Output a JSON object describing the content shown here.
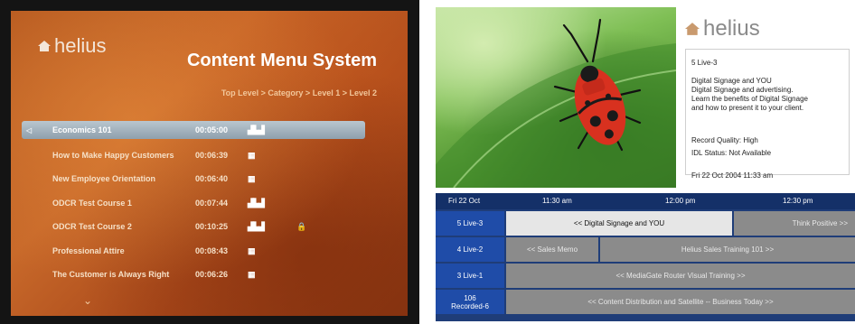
{
  "left": {
    "logo_text": "helius",
    "title": "Content Menu System",
    "breadcrumb": "Top Level > Category > Level 1 > Level 2",
    "items": [
      {
        "title": "Economics 101",
        "duration": "00:05:00",
        "icon": "chart-icon"
      },
      {
        "title": "How to Make Happy Customers",
        "duration": "00:06:39",
        "icon": "film-icon"
      },
      {
        "title": "New Employee Orientation",
        "duration": "00:06:40",
        "icon": "film-icon"
      },
      {
        "title": "ODCR Test Course 1",
        "duration": "00:07:44",
        "icon": "chart-icon"
      },
      {
        "title": "ODCR Test Course 2",
        "duration": "00:10:25",
        "icon": "chart-icon",
        "locked": true
      },
      {
        "title": "Professional Attire",
        "duration": "00:08:43",
        "icon": "film-icon"
      },
      {
        "title": "The Customer is Always Right",
        "duration": "00:06:26",
        "icon": "film-icon"
      }
    ],
    "glyphs": {
      "chart": "▟▙▟",
      "film": "▦",
      "lock": "🔒",
      "down": "⌄",
      "row": "◁"
    }
  },
  "right": {
    "logo_text": "helius",
    "info": {
      "channel": "5 Live-3",
      "title": "Digital Signage and YOU",
      "description": [
        "Digital Signage and advertising.",
        "Learn the benefits of Digital Signage",
        "and how to present it to your client."
      ],
      "record_quality": "Record Quality: High",
      "idl_status": "IDL Status:  Not Available",
      "datetime": "Fri  22 Oct 2004  11:33 am"
    },
    "guide": {
      "date": "Fri 22 Oct",
      "times": [
        "11:30 am",
        "12:00 pm",
        "12:30 pm"
      ],
      "rows": [
        {
          "channel": "5 Live-3",
          "programs": [
            {
              "label": "<< Digital Signage and YOU",
              "highlight": true
            },
            {
              "label": "Think Positive >>"
            }
          ]
        },
        {
          "channel": "4 Live-2",
          "programs": [
            {
              "label": "<< Sales Memo"
            },
            {
              "label": "Helius Sales Training 101 >>"
            }
          ]
        },
        {
          "channel": "3 Live-1",
          "programs": [
            {
              "label": "<< MediaGate Router Visual Training >>"
            }
          ]
        },
        {
          "channel": "106\nRecorded-6",
          "programs": [
            {
              "label": "<< Content Distribution and Satellite --  Business Today >>"
            }
          ]
        }
      ]
    }
  },
  "colors": {
    "orange": "#c8692a",
    "guide_blue": "#1f4ca8",
    "guide_header": "#143068",
    "program_gray": "#8b8b8b",
    "highlight": "#e6e6e6"
  }
}
